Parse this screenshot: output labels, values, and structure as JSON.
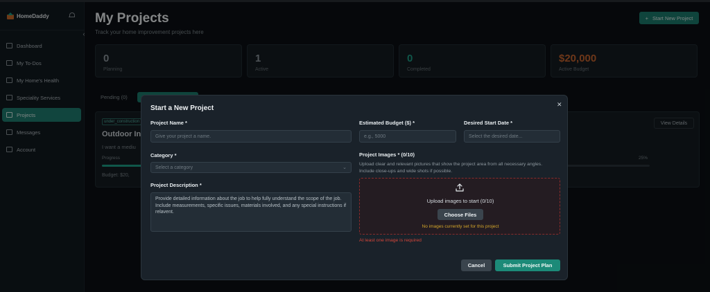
{
  "app": {
    "name": "HomeDaddy"
  },
  "sidebar": {
    "items": [
      {
        "label": "Dashboard",
        "icon": "dashboard-icon"
      },
      {
        "label": "My To-Dos",
        "icon": "todo-icon"
      },
      {
        "label": "My Home's Health",
        "icon": "heart-icon"
      },
      {
        "label": "Speciality Services",
        "icon": "services-icon"
      },
      {
        "label": "Projects",
        "icon": "folder-icon",
        "active": true
      },
      {
        "label": "Messages",
        "icon": "message-icon"
      },
      {
        "label": "Account",
        "icon": "user-icon"
      }
    ]
  },
  "header": {
    "title": "My Projects",
    "subtitle": "Track your home improvement projects here",
    "new_button": "Start New Project"
  },
  "stats": [
    {
      "value": "0",
      "label": "Planning"
    },
    {
      "value": "1",
      "label": "Active"
    },
    {
      "value": "0",
      "label": "Completed"
    },
    {
      "value": "$20,000",
      "label": "Active Budget"
    }
  ],
  "tabs": [
    {
      "label": "Pending (0)"
    },
    {
      "label": "",
      "active": true
    }
  ],
  "project": {
    "tag": "under_construction",
    "title": "Outdoor Ing",
    "desc": "I want a mediu",
    "progress_label": "Progress",
    "progress_pct": "25%",
    "progress": 0.25,
    "budget": "Budget: $20,",
    "view_button": "View Details"
  },
  "modal": {
    "title": "Start a New Project",
    "name_label": "Project Name *",
    "name_placeholder": "Give your project a name.",
    "budget_label": "Estimated Budget ($) *",
    "budget_placeholder": "e.g., 5000",
    "date_label": "Desired Start Date *",
    "date_placeholder": "Select the desired date...",
    "category_label": "Category *",
    "category_placeholder": "Select a category",
    "desc_label": "Project Description *",
    "desc_placeholder": "Provide detailed information about the job to help fully understand the scope of the job. Include measurements, specific issues, materials involved, and any special instructions if relavent.",
    "images_label": "Project Images * (0/10)",
    "images_help": "Upload clear and relevant pictures that show the project area from all necessary angles. Include close-ups and wide shots if possible.",
    "upload_text": "Upload images to start (0/10)",
    "choose_button": "Choose Files",
    "no_images_text": "No images currently set for this project",
    "error_text": "At least one image is required",
    "cancel_button": "Cancel",
    "submit_button": "Submit Project Plan"
  }
}
